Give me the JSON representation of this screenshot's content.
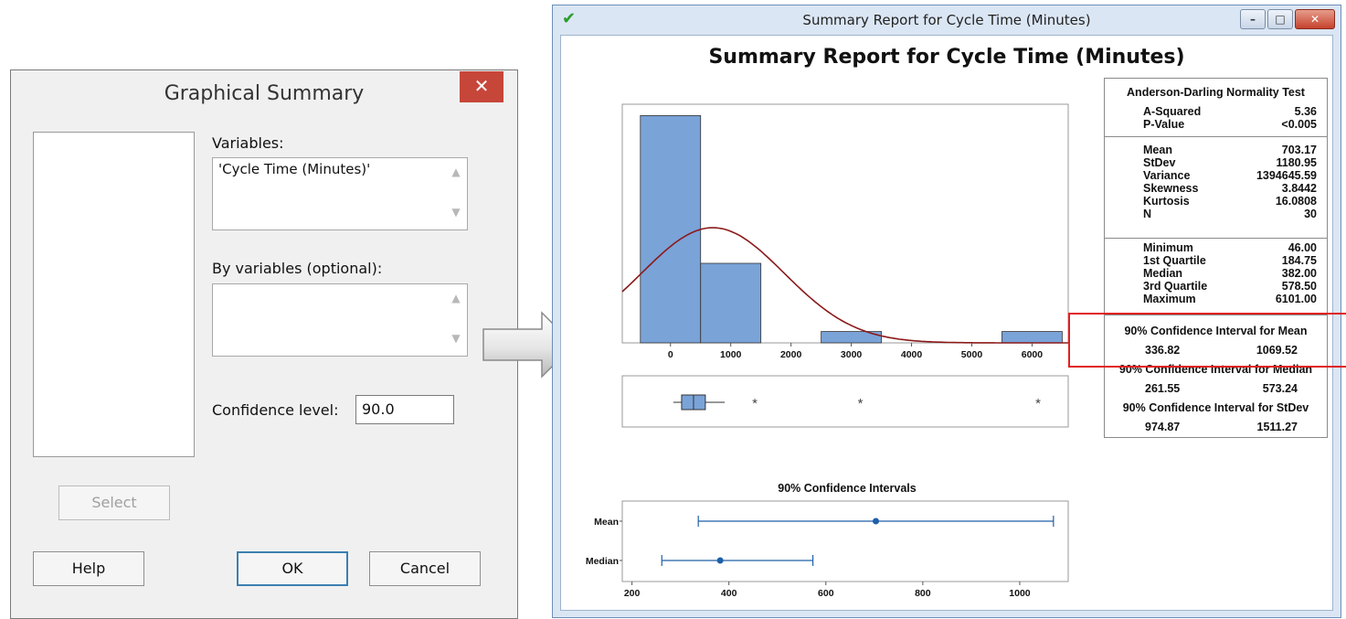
{
  "dialog": {
    "title": "Graphical Summary",
    "close_glyph": "✕",
    "variables_label": "Variables:",
    "variables_value": "'Cycle Time (Minutes)'",
    "by_variables_label": "By variables (optional):",
    "by_variables_value": "",
    "confidence_label": "Confidence level:",
    "confidence_value": "90.0",
    "select_button": "Select",
    "help_button": "Help",
    "ok_button": "OK",
    "cancel_button": "Cancel"
  },
  "window": {
    "title": "Summary Report for Cycle Time (Minutes)",
    "status_icon": "check-icon",
    "minimize_glyph": "–",
    "maximize_glyph": "□",
    "close_glyph": "✕"
  },
  "report": {
    "title": "Summary Report for Cycle Time (Minutes)",
    "normality_test": {
      "heading": "Anderson-Darling Normality Test",
      "rows": [
        {
          "label": "A-Squared",
          "value": "5.36"
        },
        {
          "label": "P-Value",
          "value": "<0.005"
        }
      ]
    },
    "moments": [
      {
        "label": "Mean",
        "value": "703.17"
      },
      {
        "label": "StDev",
        "value": "1180.95"
      },
      {
        "label": "Variance",
        "value": "1394645.59"
      },
      {
        "label": "Skewness",
        "value": "3.8442"
      },
      {
        "label": "Kurtosis",
        "value": "16.0808"
      },
      {
        "label": "N",
        "value": "30"
      }
    ],
    "quartiles": [
      {
        "label": "Minimum",
        "value": "46.00"
      },
      {
        "label": "1st Quartile",
        "value": "184.75"
      },
      {
        "label": "Median",
        "value": "382.00"
      },
      {
        "label": "3rd Quartile",
        "value": "578.50"
      },
      {
        "label": "Maximum",
        "value": "6101.00"
      }
    ],
    "intervals": [
      {
        "heading": "90% Confidence Interval for Mean",
        "lower": "336.82",
        "upper": "1069.52"
      },
      {
        "heading": "90% Confidence Interval for Median",
        "lower": "261.55",
        "upper": "573.24"
      },
      {
        "heading": "90% Confidence Interval for StDev",
        "lower": "974.87",
        "upper": "1511.27"
      }
    ]
  },
  "chart_data": [
    {
      "type": "bar",
      "subtype": "histogram",
      "bins": [
        [
          -500,
          500
        ],
        [
          500,
          1500
        ],
        [
          1500,
          2500
        ],
        [
          2500,
          3500
        ],
        [
          3500,
          4500
        ],
        [
          4500,
          5500
        ],
        [
          5500,
          6500
        ]
      ],
      "values": [
        20,
        7,
        0,
        1,
        0,
        0,
        1
      ],
      "normal_fit": {
        "mean": 703.17,
        "stdev": 1180.95,
        "n": 30,
        "bin_width": 1000
      },
      "xticks": [
        "0",
        "1000",
        "2000",
        "3000",
        "4000",
        "5000",
        "6000"
      ],
      "xlim": [
        -800,
        6600
      ],
      "ylim": [
        0,
        21
      ],
      "bar_color": "#7aa3d8",
      "curve_color": "#8b1a1a"
    },
    {
      "type": "box",
      "q1": 184.75,
      "median": 382.0,
      "q3": 578.5,
      "whisker_low": 46.0,
      "whisker_high": 900.0,
      "outliers": [
        1400,
        3150,
        6101
      ],
      "xlim": [
        -800,
        6600
      ],
      "box_color": "#7aa3d8"
    },
    {
      "type": "interval",
      "title": "90% Confidence Intervals",
      "categories": [
        "Mean",
        "Median"
      ],
      "estimates": [
        703.17,
        382.0
      ],
      "lower": [
        336.82,
        261.55
      ],
      "upper": [
        1069.52,
        573.24
      ],
      "xticks": [
        "200",
        "400",
        "600",
        "800",
        "1000"
      ],
      "xlim": [
        180,
        1100
      ],
      "color": "#1f5fa8"
    }
  ]
}
